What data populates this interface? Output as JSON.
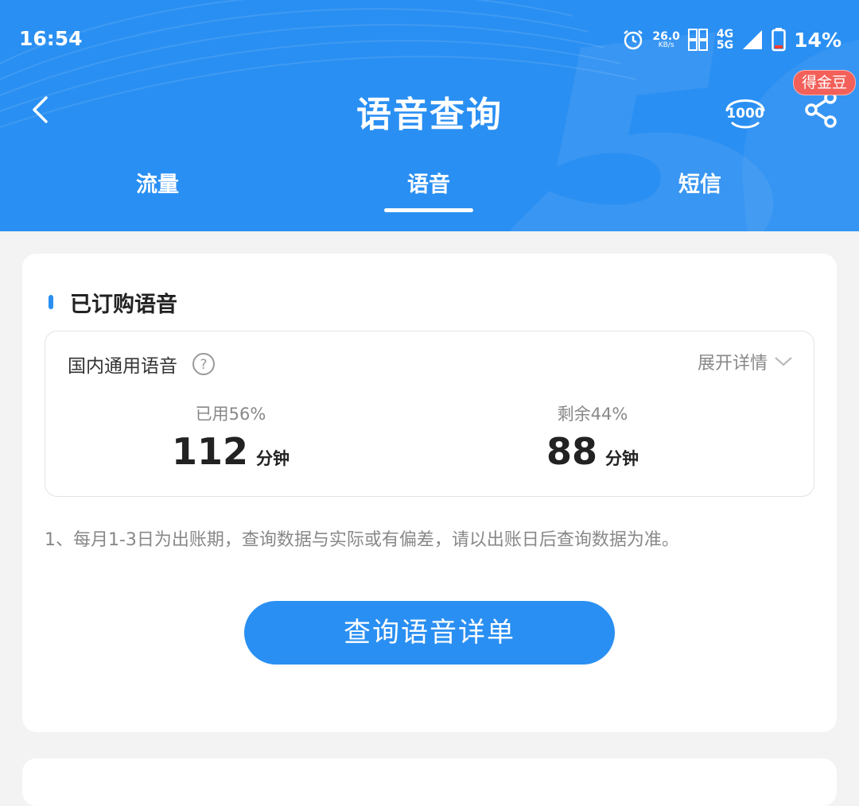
{
  "status_bar": {
    "time": "16:54",
    "net_speed_value": "26.0",
    "net_speed_unit": "KB/s",
    "net_type_top": "4G",
    "net_type_bottom": "5G",
    "battery": "14%"
  },
  "header": {
    "title": "语音查询",
    "badge": "得金豆",
    "hotline_icon": "10000-hotline-icon"
  },
  "tabs": [
    {
      "label": "流量",
      "active": false
    },
    {
      "label": "语音",
      "active": true
    },
    {
      "label": "短信",
      "active": false
    }
  ],
  "card": {
    "section_title": "已订购语音",
    "package_name": "国内通用语音",
    "expand_label": "展开详情",
    "used_label": "已用56%",
    "used_value": "112",
    "used_unit": "分钟",
    "remaining_label": "剩余44%",
    "remaining_value": "88",
    "remaining_unit": "分钟",
    "note": "1、每月1-3日为出账期，查询数据与实际或有偏差，请以出账日后查询数据为准。",
    "button_label": "查询语音详单"
  },
  "colors": {
    "header_blue": "#2a8ff2",
    "badge_red": "#f3605a",
    "button_blue": "#2a8ff2"
  }
}
